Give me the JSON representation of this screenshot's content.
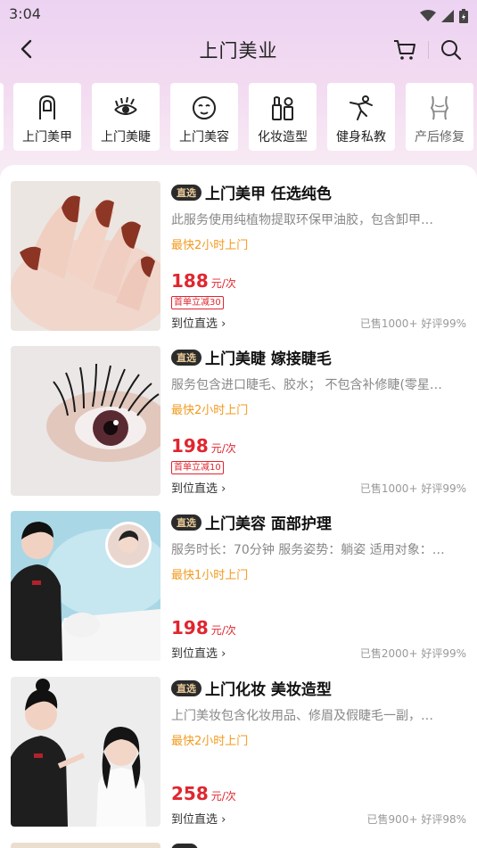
{
  "status_bar": {
    "time": "3:04"
  },
  "header": {
    "title": "上门美业"
  },
  "categories": [
    {
      "label": "上门美甲",
      "icon": "nail-icon"
    },
    {
      "label": "上门美睫",
      "icon": "eyelash-icon"
    },
    {
      "label": "上门美容",
      "icon": "face-mask-icon"
    },
    {
      "label": "化妆造型",
      "icon": "makeup-icon"
    },
    {
      "label": "健身私教",
      "icon": "fitness-icon"
    },
    {
      "label": "产后修复",
      "icon": "body-shape-icon"
    }
  ],
  "products": [
    {
      "badge": "直选",
      "title": "上门美甲 任选纯色",
      "desc": "此服务使用纯植物提取环保甲油胶，包含卸甲…",
      "fast": "最快2小时上门",
      "price": "188",
      "unit": "元/次",
      "coupon": "首单立减30",
      "delivery": "到位直选",
      "sold": "已售1000+ 好评99%"
    },
    {
      "badge": "直选",
      "title": "上门美睫 嫁接睫毛",
      "desc": "服务包含进口睫毛、胶水； 不包含补修睫(零星…",
      "fast": "最快2小时上门",
      "price": "198",
      "unit": "元/次",
      "coupon": "首单立减10",
      "delivery": "到位直选",
      "sold": "已售1000+ 好评99%"
    },
    {
      "badge": "直选",
      "title": "上门美容 面部护理",
      "desc": "服务时长：70分钟 服务姿势：躺姿 适用对象：…",
      "fast": "最快1小时上门",
      "price": "198",
      "unit": "元/次",
      "coupon": "",
      "delivery": "到位直选",
      "sold": "已售2000+ 好评99%"
    },
    {
      "badge": "直选",
      "title": "上门化妆 美妆造型",
      "desc": "上门美妆包含化妆用品、修眉及假睫毛一副，…",
      "fast": "最快2小时上门",
      "price": "258",
      "unit": "元/次",
      "coupon": "",
      "delivery": "到位直选",
      "sold": "已售900+ 好评98%"
    }
  ],
  "colors": {
    "price": "#e0262f",
    "fast": "#f39a1e",
    "badge_bg": "#2b2b2b",
    "badge_text": "#e8c999"
  }
}
